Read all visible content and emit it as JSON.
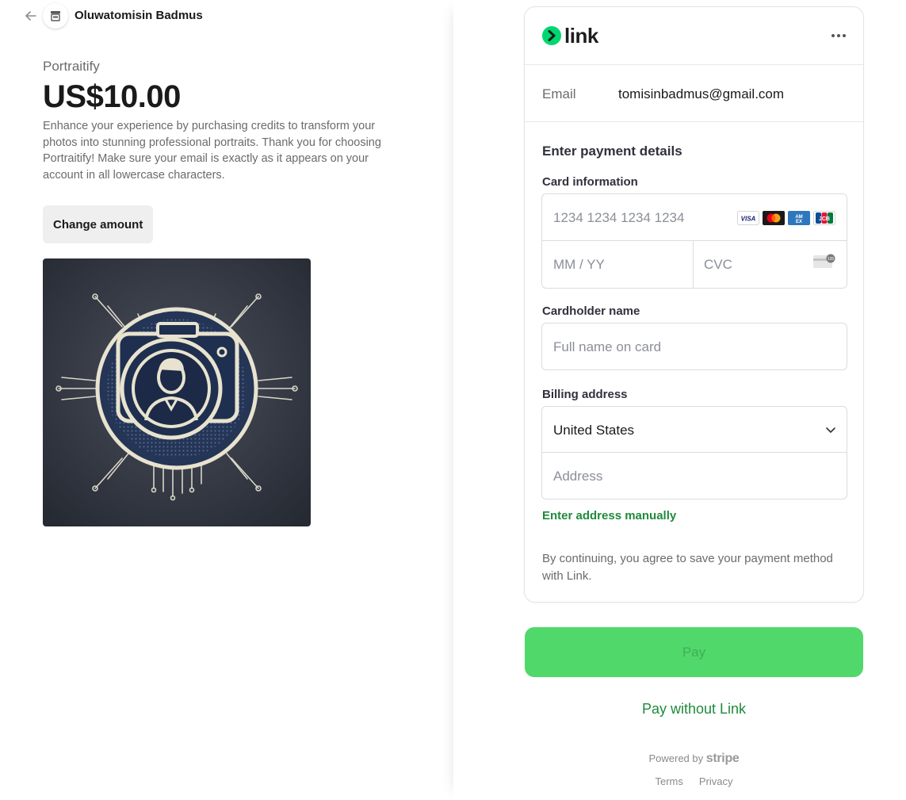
{
  "merchant": {
    "name": "Oluwatomisin Badmus"
  },
  "product": {
    "name": "Portraitify",
    "price": "US$10.00",
    "description": "Enhance your experience by purchasing credits to transform your photos into stunning professional portraits. Thank you for choosing Portraitify! Make sure your email is exactly as it appears on your account in all lowercase characters.",
    "change_amount_label": "Change amount"
  },
  "link": {
    "logo_word": "link",
    "email_label": "Email",
    "email_value": "tomisinbadmus@gmail.com",
    "brand_color": "#00d66f"
  },
  "payment": {
    "title": "Enter payment details",
    "card_info_label": "Card information",
    "card_number_placeholder": "1234 1234 1234 1234",
    "expiry_placeholder": "MM / YY",
    "cvc_placeholder": "CVC",
    "card_brands": [
      "visa-icon",
      "mastercard-icon",
      "amex-icon",
      "jcb-icon"
    ],
    "cardholder_label": "Cardholder name",
    "cardholder_placeholder": "Full name on card",
    "billing_label": "Billing address",
    "country_value": "United States",
    "address_placeholder": "Address",
    "manual_address_label": "Enter address manually",
    "consent_text": "By continuing, you agree to save your payment method with Link."
  },
  "actions": {
    "pay_label": "Pay",
    "pay_without_link_label": "Pay without Link",
    "pay_color": "#51d86b",
    "link_color": "#1f8a3b"
  },
  "footer": {
    "powered_by": "Powered by",
    "brand": "stripe",
    "terms": "Terms",
    "privacy": "Privacy"
  }
}
